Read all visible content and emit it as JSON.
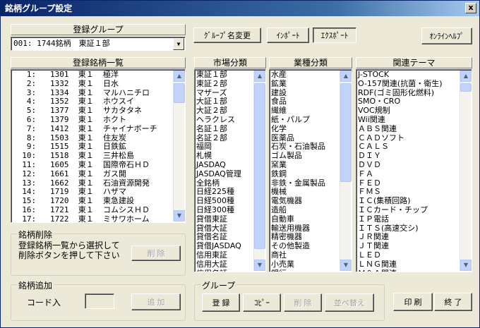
{
  "window": {
    "title": "銘柄グループ設定",
    "close_label": "x"
  },
  "group": {
    "header": "登録グループ",
    "selected": "001: 1744銘柄　東証１部"
  },
  "toolbar": {
    "rename": "ｸﾞﾙｰﾌﾟ名変更",
    "import": "ｲﾝﾎﾟｰﾄ",
    "export": "ｴｸｽﾎﾟｰﾄ",
    "online_help": "ｵﾝﾗｲﾝﾍﾙﾌﾟ"
  },
  "stock_list": {
    "header": "登録銘柄一覧",
    "rows": [
      "   1:   1301  東１  極洋",
      "   2:   1332  東１  日水",
      "   3:   1334  東１  マルハニチロ",
      "   4:   1352  東１  ホウスイ",
      "   5:   1377  東１  サカタタネ",
      "   6:   1379  東１  ホクト",
      "   7:   1412  東１  チャイナボーチ",
      "   8:   1503  東１  住友炭",
      "   9:   1515  東１  日鉄鉱",
      "  10:   1518  東１  三井松島",
      "  11:   1605  東１  国際帝石ＨＤ",
      "  12:   1661  東１  ガス開",
      "  13:   1662  東１  石油資源開発",
      "  14:   1719  東１  ハザマ",
      "  15:   1720  東１  東急建設",
      "  16:   1721  東１  コムシスＨＤ",
      "  17:   1722  東１  ミサワホーム"
    ]
  },
  "market": {
    "header": "市場分類",
    "items": [
      "東証１部",
      "東証２部",
      "マザーズ",
      "大証１部",
      "大証２部",
      "ヘラクレス",
      "名証１部",
      "名証２部",
      "福岡",
      "札幌",
      "JASDAQ",
      "JASDAQ管理",
      "全銘柄",
      "日経225種",
      "日経500種",
      "日経300種",
      "貸借東証",
      "貸借大証",
      "貸借名証",
      "貸借JASDAQ",
      "信用東証",
      "信用大証",
      "信用名証"
    ]
  },
  "industry": {
    "header": "業種分類",
    "items": [
      "水産",
      "鉱業",
      "建設",
      "食品",
      "繊維",
      "紙・パルプ",
      "化学",
      "医薬品",
      "石炭・石油製品",
      "ゴム製品",
      "窯業",
      "鉄鋼",
      "非鉄・金属製品",
      "機械",
      "電気機器",
      "造船",
      "自動車",
      "輸送用機器",
      "精密機器",
      "その他製造",
      "商社",
      "小売業",
      "銀行"
    ]
  },
  "theme": {
    "header": "関連テーマ",
    "items": [
      "J-STOCK",
      "O-157関連(抗菌・衛生)",
      "RDF(ゴミ固形化燃料)",
      "SMO・CRO",
      "VOC規制",
      "Wii関連",
      "ＡＢＳ関連",
      "ＣＡＤソフト",
      "ＣＡＬＳ",
      "ＤＩＹ",
      "ＤＶＤ",
      "ＦＡ",
      "ＦＥＤ",
      "ＦＭＳ",
      "ＩＣ(集積回路)",
      "ＩＣカード・チップ",
      "ＩＰ電話",
      "ＩＴＳ(高速交シ)",
      "ＪＲ関連",
      "ＪＴ関連",
      "ＬＥＤ",
      "ＬＮＧ関連",
      "Ｍ＆Ａ関連"
    ]
  },
  "delete_section": {
    "title": "銘柄削除",
    "instruction": "登録銘柄一覧から選択して削除ボタンを押して下さい",
    "delete_button": "削 除"
  },
  "add_section": {
    "title": "銘柄追加",
    "code_label": "コード入",
    "code_value": "",
    "add_button": "追 加"
  },
  "group_section": {
    "title": "グループ",
    "register": "登 録",
    "copy": "ｺﾋﾟｰ",
    "delete": "削 除",
    "sort": "並べ替え"
  },
  "print_button": "印 刷",
  "close_button": "終 了",
  "colors": {
    "title_start": "#0a246a",
    "title_end": "#a6caf0",
    "face": "#ece9d8"
  }
}
